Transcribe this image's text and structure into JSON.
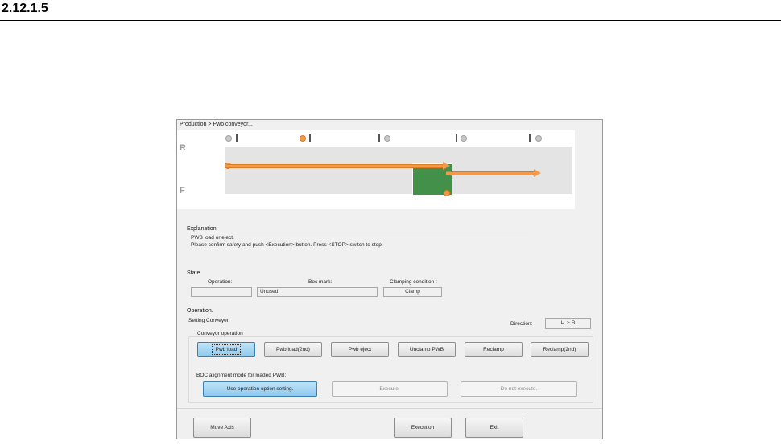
{
  "doc": {
    "heading": "2.12.1.5"
  },
  "window": {
    "title": "Production > Pwb conveyor..."
  },
  "conveyor_view": {
    "row_rear_label": "R",
    "row_front_label": "F",
    "sensor_states": [
      "off",
      "on",
      "off",
      "off",
      "off"
    ],
    "colors": {
      "active": "#f29a4a",
      "inactive": "#c8c8c8",
      "pwb": "#43904a",
      "lane": "#e4e4e4"
    }
  },
  "explanation": {
    "header": "Explanation",
    "line1": "PWB load or eject.",
    "line2": "Please confirm safety and push <Execution> button. Press <STOP> switch to stop."
  },
  "state": {
    "header": "State",
    "operation_label": "Operation:",
    "operation_value": "",
    "boc_label": "Boc mark:",
    "boc_value": "Unused",
    "clamp_label": "Clamping condition :",
    "clamp_value": "Clamp"
  },
  "operation": {
    "header": "Operation.",
    "setting_label": "Setting Conveyer",
    "direction_label": "Direction:",
    "direction_value": "L -> R",
    "conveyor_group_label": "Conveyor operation",
    "buttons": [
      "Pwb load",
      "Pwb load(2nd)",
      "Pwb eject",
      "Unclamp PWB",
      "Reclamp",
      "Reclamp(2nd)"
    ],
    "boc_group_label": "BOC alignment mode for loaded PWB:",
    "boc_buttons": [
      "Use operation option setting.",
      "Execute.",
      "Do not execute."
    ]
  },
  "footer": {
    "move_axis": "Move Axis",
    "execution": "Execution",
    "exit": "Exit"
  }
}
